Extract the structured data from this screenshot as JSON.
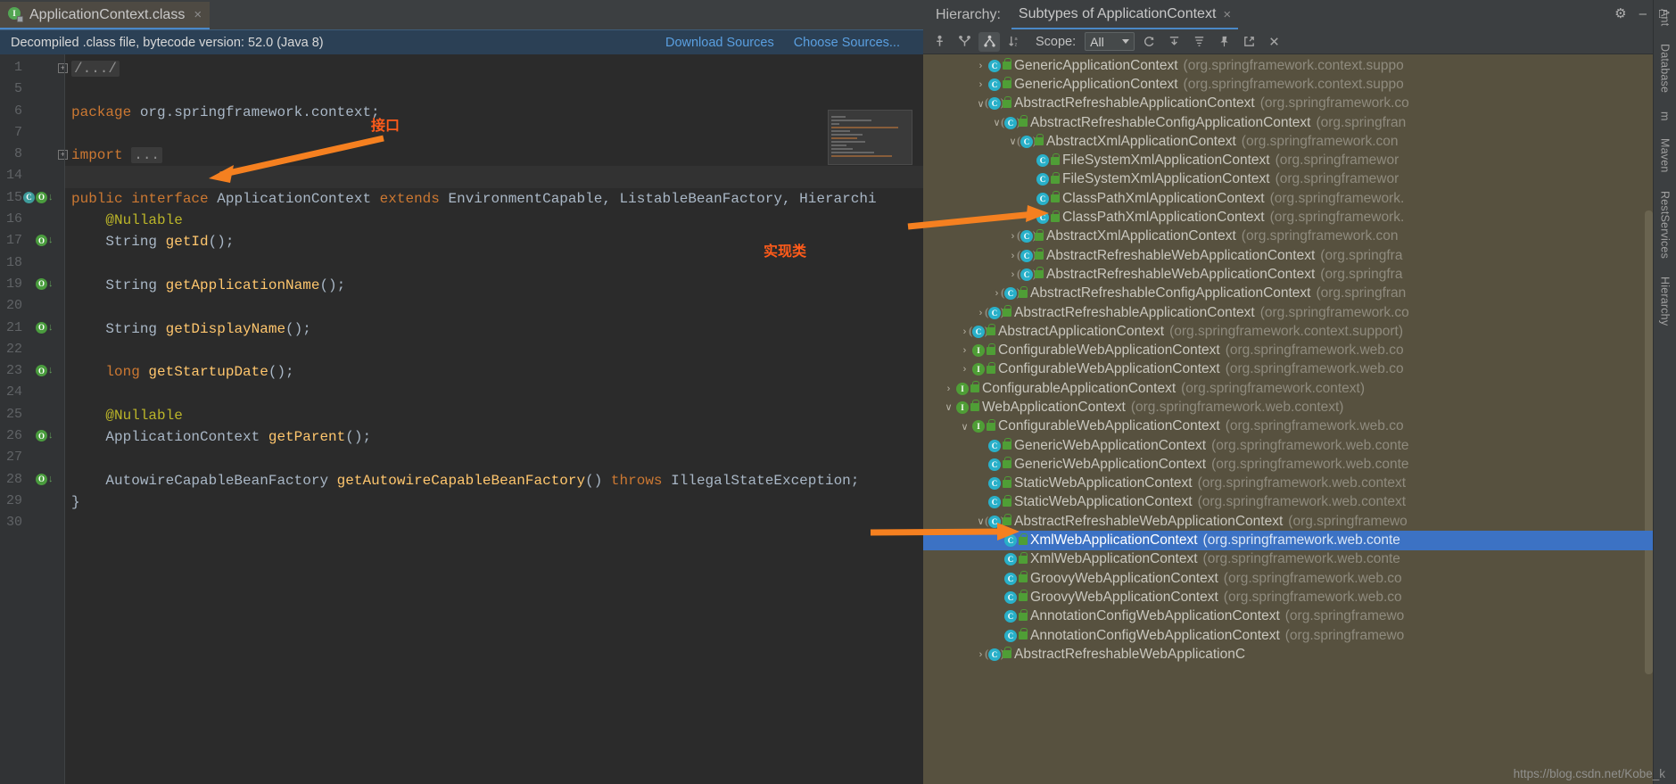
{
  "editor": {
    "tab": {
      "label": "ApplicationContext.class",
      "icon": "interface-class-file-icon",
      "close": "×"
    },
    "notice": {
      "text": "Decompiled .class file, bytecode version: 52.0 (Java 8)",
      "download_sources": "Download Sources",
      "choose_sources": "Choose Sources..."
    },
    "line_numbers": [
      "1",
      "5",
      "6",
      "7",
      "8",
      "14",
      "15",
      "16",
      "17",
      "18",
      "19",
      "20",
      "21",
      "22",
      "23",
      "24",
      "25",
      "26",
      "27",
      "28",
      "29",
      "30"
    ],
    "lines": [
      {
        "num": "1",
        "fold": "+",
        "segments": [
          {
            "t": "/.../",
            "c": "fold-chip"
          }
        ]
      },
      {
        "num": "5",
        "segments": []
      },
      {
        "num": "6",
        "segments": [
          {
            "t": "package ",
            "c": "kw"
          },
          {
            "t": "org.springframework.context;",
            "c": "pln"
          }
        ]
      },
      {
        "num": "7",
        "segments": []
      },
      {
        "num": "8",
        "fold": "+",
        "segments": [
          {
            "t": "import ",
            "c": "kw"
          },
          {
            "t": "...",
            "c": "fold-chip"
          }
        ]
      },
      {
        "num": "14",
        "highlight": true,
        "segments": []
      },
      {
        "num": "15",
        "segments": [
          {
            "t": "public interface ",
            "c": "kw"
          },
          {
            "t": "ApplicationContext ",
            "c": "cls"
          },
          {
            "t": "extends ",
            "c": "kw"
          },
          {
            "t": "EnvironmentCapable, ListableBeanFactory, Hierarchi",
            "c": "cls"
          }
        ]
      },
      {
        "num": "16",
        "segments": [
          {
            "t": "    @Nullable",
            "c": "ann"
          }
        ]
      },
      {
        "num": "17",
        "segments": [
          {
            "t": "    String ",
            "c": "cls"
          },
          {
            "t": "getId",
            "c": "mth"
          },
          {
            "t": "();",
            "c": "pln"
          }
        ]
      },
      {
        "num": "18",
        "segments": []
      },
      {
        "num": "19",
        "segments": [
          {
            "t": "    String ",
            "c": "cls"
          },
          {
            "t": "getApplicationName",
            "c": "mth"
          },
          {
            "t": "();",
            "c": "pln"
          }
        ]
      },
      {
        "num": "20",
        "segments": []
      },
      {
        "num": "21",
        "segments": [
          {
            "t": "    String ",
            "c": "cls"
          },
          {
            "t": "getDisplayName",
            "c": "mth"
          },
          {
            "t": "();",
            "c": "pln"
          }
        ]
      },
      {
        "num": "22",
        "segments": []
      },
      {
        "num": "23",
        "segments": [
          {
            "t": "    long ",
            "c": "kw"
          },
          {
            "t": "getStartupDate",
            "c": "mth"
          },
          {
            "t": "();",
            "c": "pln"
          }
        ]
      },
      {
        "num": "24",
        "segments": []
      },
      {
        "num": "25",
        "segments": [
          {
            "t": "    @Nullable",
            "c": "ann"
          }
        ]
      },
      {
        "num": "26",
        "segments": [
          {
            "t": "    ApplicationContext ",
            "c": "cls"
          },
          {
            "t": "getParent",
            "c": "mth"
          },
          {
            "t": "();",
            "c": "pln"
          }
        ]
      },
      {
        "num": "27",
        "segments": []
      },
      {
        "num": "28",
        "segments": [
          {
            "t": "    AutowireCapableBeanFactory ",
            "c": "cls"
          },
          {
            "t": "getAutowireCapableBeanFactory",
            "c": "mth"
          },
          {
            "t": "() ",
            "c": "pln"
          },
          {
            "t": "throws ",
            "c": "kw"
          },
          {
            "t": "IllegalStateException;",
            "c": "cls"
          }
        ]
      },
      {
        "num": "29",
        "segments": [
          {
            "t": "}",
            "c": "pln"
          }
        ]
      },
      {
        "num": "30",
        "segments": []
      }
    ]
  },
  "annotations": {
    "interface_label": "接口",
    "implementation_label": "实现类",
    "arrow_color": "#f58020"
  },
  "hierarchy": {
    "title": "Hierarchy:",
    "tab_label": "Subtypes of ApplicationContext",
    "tab_close": "×",
    "toolbar": {
      "supertypes": "supertypes-hierarchy-icon",
      "subtypes": "subtypes-hierarchy-icon",
      "class_hierarchy": "class-hierarchy-icon",
      "sort_alpha": "sort-alphabetically-icon",
      "scope_label": "Scope:",
      "scope_value": "All",
      "refresh": "refresh-icon",
      "expand_all": "expand-all-icon",
      "collapse_all": "collapse-all-icon",
      "pin": "pin-tab-icon",
      "open_in_editor": "open-in-editor-icon",
      "close": "close-icon"
    },
    "nodes": [
      {
        "indent": 0,
        "twist": ">",
        "kind": "class",
        "name": "GenericApplicationContext",
        "pkg": "(org.springframework.context.suppo"
      },
      {
        "indent": 0,
        "twist": ">",
        "kind": "class",
        "name": "GenericApplicationContext",
        "pkg": "(org.springframework.context.suppo"
      },
      {
        "indent": 0,
        "twist": "v",
        "kind": "abstract",
        "name": "AbstractRefreshableApplicationContext",
        "pkg": "(org.springframework.co"
      },
      {
        "indent": 1,
        "twist": "v",
        "kind": "abstract",
        "name": "AbstractRefreshableConfigApplicationContext",
        "pkg": "(org.springfran"
      },
      {
        "indent": 2,
        "twist": "v",
        "kind": "abstract",
        "name": "AbstractXmlApplicationContext",
        "pkg": "(org.springframework.con"
      },
      {
        "indent": 3,
        "twist": "",
        "kind": "class",
        "name": "FileSystemXmlApplicationContext",
        "pkg": "(org.springframewor"
      },
      {
        "indent": 3,
        "twist": "",
        "kind": "class",
        "name": "FileSystemXmlApplicationContext",
        "pkg": "(org.springframewor"
      },
      {
        "indent": 3,
        "twist": "",
        "kind": "class",
        "name": "ClassPathXmlApplicationContext",
        "pkg": "(org.springframework."
      },
      {
        "indent": 3,
        "twist": "",
        "kind": "class",
        "name": "ClassPathXmlApplicationContext",
        "pkg": "(org.springframework."
      },
      {
        "indent": 2,
        "twist": ">",
        "kind": "abstract",
        "name": "AbstractXmlApplicationContext",
        "pkg": "(org.springframework.con"
      },
      {
        "indent": 2,
        "twist": ">",
        "kind": "abstract",
        "name": "AbstractRefreshableWebApplicationContext",
        "pkg": "(org.springfra"
      },
      {
        "indent": 2,
        "twist": ">",
        "kind": "abstract",
        "name": "AbstractRefreshableWebApplicationContext",
        "pkg": "(org.springfra"
      },
      {
        "indent": 1,
        "twist": ">",
        "kind": "abstract",
        "name": "AbstractRefreshableConfigApplicationContext",
        "pkg": "(org.springfran"
      },
      {
        "indent": 0,
        "twist": ">",
        "kind": "abstract",
        "name": "AbstractRefreshableApplicationContext",
        "pkg": "(org.springframework.co"
      },
      {
        "indent": -1,
        "twist": ">",
        "kind": "abstract",
        "name": "AbstractApplicationContext",
        "pkg": "(org.springframework.context.support)"
      },
      {
        "indent": -1,
        "twist": ">",
        "kind": "interface",
        "name": "ConfigurableWebApplicationContext",
        "pkg": "(org.springframework.web.co"
      },
      {
        "indent": -1,
        "twist": ">",
        "kind": "interface",
        "name": "ConfigurableWebApplicationContext",
        "pkg": "(org.springframework.web.co"
      },
      {
        "indent": -2,
        "twist": ">",
        "kind": "interface",
        "name": "ConfigurableApplicationContext",
        "pkg": "(org.springframework.context)"
      },
      {
        "indent": -2,
        "twist": "v",
        "kind": "interface",
        "name": "WebApplicationContext",
        "pkg": "(org.springframework.web.context)"
      },
      {
        "indent": -1,
        "twist": "v",
        "kind": "interface",
        "name": "ConfigurableWebApplicationContext",
        "pkg": "(org.springframework.web.co"
      },
      {
        "indent": 0,
        "twist": "",
        "kind": "class",
        "name": "GenericWebApplicationContext",
        "pkg": "(org.springframework.web.conte"
      },
      {
        "indent": 0,
        "twist": "",
        "kind": "class",
        "name": "GenericWebApplicationContext",
        "pkg": "(org.springframework.web.conte"
      },
      {
        "indent": 0,
        "twist": "",
        "kind": "class",
        "name": "StaticWebApplicationContext",
        "pkg": "(org.springframework.web.context"
      },
      {
        "indent": 0,
        "twist": "",
        "kind": "class",
        "name": "StaticWebApplicationContext",
        "pkg": "(org.springframework.web.context"
      },
      {
        "indent": 0,
        "twist": "v",
        "kind": "abstract",
        "name": "AbstractRefreshableWebApplicationContext",
        "pkg": "(org.springframewo"
      },
      {
        "indent": 1,
        "twist": "",
        "kind": "class",
        "name": "XmlWebApplicationContext",
        "pkg": "(org.springframework.web.conte",
        "selected": true
      },
      {
        "indent": 1,
        "twist": "",
        "kind": "class",
        "name": "XmlWebApplicationContext",
        "pkg": "(org.springframework.web.conte"
      },
      {
        "indent": 1,
        "twist": "",
        "kind": "class",
        "name": "GroovyWebApplicationContext",
        "pkg": "(org.springframework.web.co"
      },
      {
        "indent": 1,
        "twist": "",
        "kind": "class",
        "name": "GroovyWebApplicationContext",
        "pkg": "(org.springframework.web.co"
      },
      {
        "indent": 1,
        "twist": "",
        "kind": "class",
        "name": "AnnotationConfigWebApplicationContext",
        "pkg": "(org.springframewo"
      },
      {
        "indent": 1,
        "twist": "",
        "kind": "class",
        "name": "AnnotationConfigWebApplicationContext",
        "pkg": "(org.springframewo"
      },
      {
        "indent": 0,
        "twist": ">",
        "kind": "abstract",
        "name": "AbstractRefreshableWebApplicationC",
        "pkg": ""
      }
    ]
  },
  "tool_strip": [
    "Ant",
    "Database",
    "m",
    "Maven",
    "RestServices",
    "Hierarchy"
  ],
  "window_controls": {
    "settings": "gear-icon",
    "minimize": "minimize-icon",
    "maximize": "maximize-icon"
  },
  "watermark": "https://blog.csdn.net/Kobe_k"
}
